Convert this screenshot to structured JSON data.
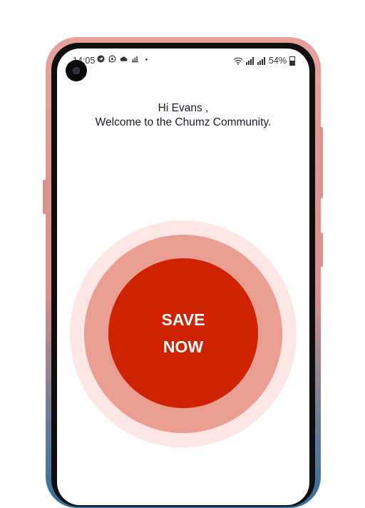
{
  "status_bar": {
    "time": "14:05",
    "battery": "54%",
    "icons": [
      "telegram-icon",
      "whatsapp-icon",
      "cloud-icon",
      "chart-icon",
      "dot-icon",
      "wifi-icon",
      "signal-icon",
      "signal-icon",
      "battery-icon"
    ]
  },
  "greeting": {
    "line1": "Hi Evans ,",
    "line2": "Welcome to the Chumz Community."
  },
  "save_button": {
    "line1": "SAVE",
    "line2": "NOW"
  },
  "colors": {
    "primary": "#cf2200",
    "ring_inner": "#ea9e92",
    "ring_outer": "#fde6e4",
    "phone_frame": "#e7a19a"
  }
}
